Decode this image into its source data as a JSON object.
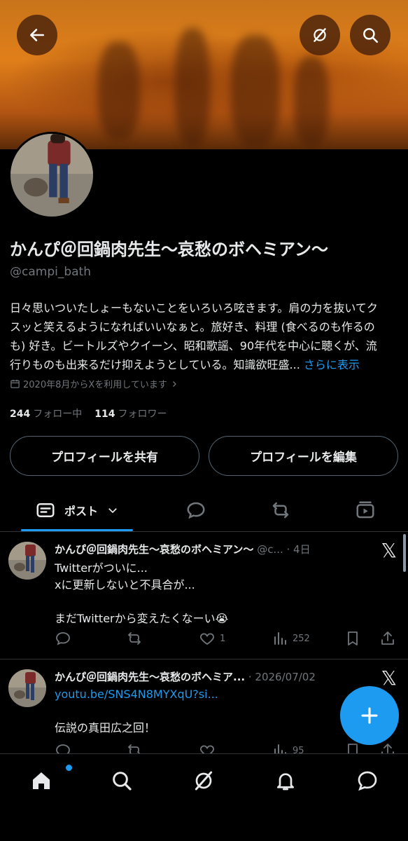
{
  "header": {
    "back_icon": "back-arrow-icon",
    "grok_icon": "grok-icon",
    "search_icon": "search-icon"
  },
  "profile": {
    "display_name": "かんぴ＠回鍋肉先生〜哀愁のボヘミアン〜",
    "handle": "@campi_bath",
    "bio_lines": [
      "日々思いついたしょーもないことをいろいろ呟きます。肩の力を抜いてク",
      "スッと笑えるようになればいいなぁと。旅好き、料理 (食べるのも作るの",
      "も) 好き。ビートルズやクイーン、昭和歌謡、90年代を中心に聴くが、流",
      "行りものも出来るだけ抑えようとしている。知識欲旺盛..."
    ],
    "bio_more": "さらに表示",
    "joined": "2020年8月からXを利用しています",
    "following_count": "244",
    "following_label": "フォロー中",
    "followers_count": "114",
    "followers_label": "フォロワー",
    "share_button": "プロフィールを共有",
    "edit_button": "プロフィールを編集"
  },
  "tabs": {
    "posts_label": "ポスト"
  },
  "posts": [
    {
      "name": "かんぴ＠回鍋肉先生〜哀愁のボヘミアン〜",
      "meta": "@c... · 4日",
      "lines": [
        "Twitterがついに...",
        "xに更新しないと不具合が...",
        "",
        "まだTwitterから変えたくなーい😭"
      ],
      "likes": "1",
      "views": "252"
    },
    {
      "name": "かんぴ＠回鍋肉先生〜哀愁のボヘミア...",
      "meta": "· 2026/07/02",
      "link": "youtu.be/SNS4N8MYXqU?si...",
      "lines": [
        "伝説の真田広之回！"
      ],
      "views": "95"
    }
  ],
  "colors": {
    "accent": "#1d9bf0",
    "muted": "#71767b",
    "text": "#e7e9ea",
    "background": "#000000"
  }
}
